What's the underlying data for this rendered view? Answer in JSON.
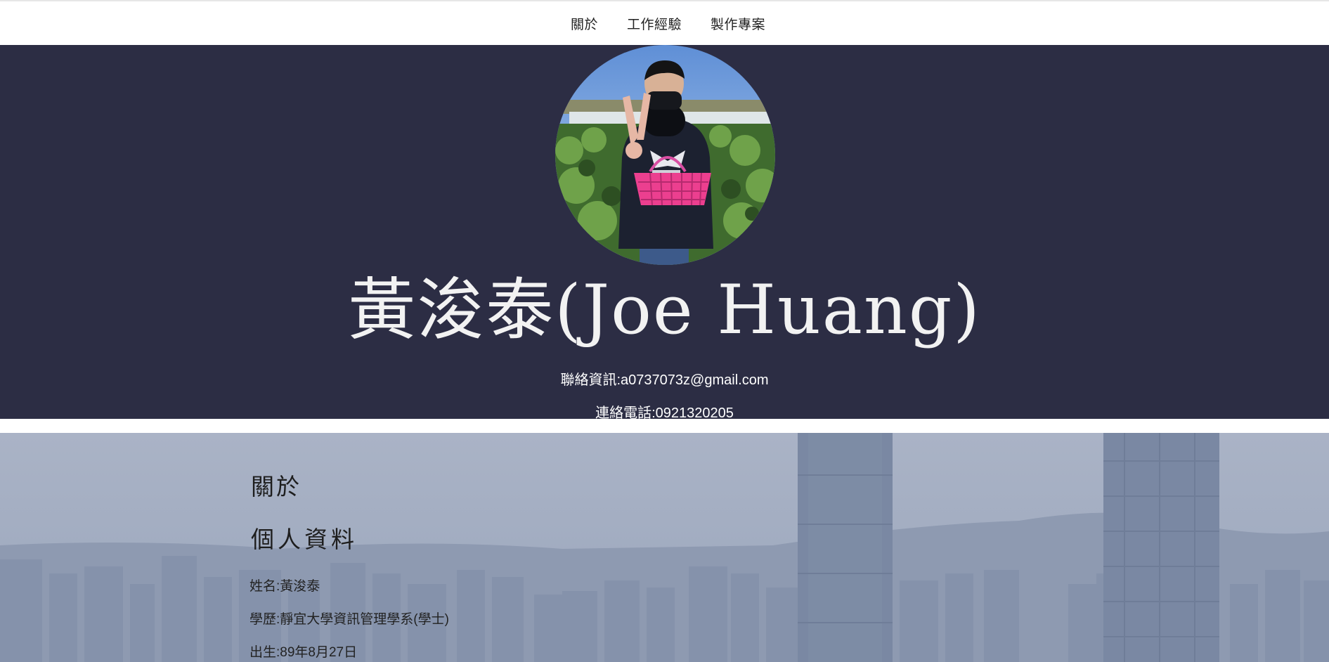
{
  "nav": {
    "items": [
      {
        "label": "關於"
      },
      {
        "label": "工作經驗"
      },
      {
        "label": "製作專案"
      }
    ]
  },
  "hero": {
    "name": "黃浚泰(Joe Huang)",
    "email_line": "聯絡資訊:a0737073z@gmail.com",
    "phone_line": "連絡電話:0921320205",
    "background_color": "#2c2d44"
  },
  "about": {
    "heading": "關於",
    "subheading": "個人資料",
    "fields": [
      {
        "text": "姓名:黃浚泰"
      },
      {
        "text": "學歷:靜宜大學資訊管理學系(學士)"
      },
      {
        "text": "出生:89年8月27日"
      }
    ]
  }
}
